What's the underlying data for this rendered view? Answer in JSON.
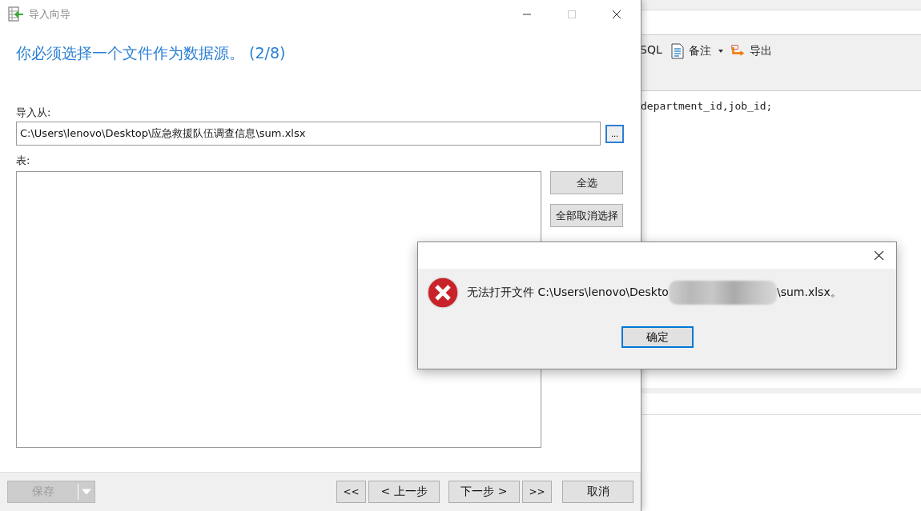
{
  "background_app": {
    "toolbar": [
      {
        "kind": "sql",
        "label": "SQL"
      },
      {
        "kind": "note",
        "label": "备注",
        "dropdown": true
      },
      {
        "kind": "export",
        "label": "导出"
      }
    ],
    "editor_line": "department_id,job_id;"
  },
  "wizard": {
    "title": "导入向导",
    "heading": "你必须选择一个文件作为数据源。 (2/8)",
    "source_label": "导入从:",
    "source_value": "C:\\Users\\lenovo\\Desktop\\应急救援队伍调查信息\\sum.xlsx",
    "browse_button": "...",
    "tables_label": "表:",
    "side_buttons": [
      "全选",
      "全部取消选择"
    ],
    "save_button": {
      "label": "保存",
      "disabled": true
    },
    "nav_buttons": [
      "<<",
      "< 上一步",
      "下一步 >",
      ">>",
      "取消"
    ]
  },
  "error_dialog": {
    "message_start": "无法打开文件 C:\\Users\\lenovo\\Deskto",
    "message_end": "\\sum.xlsx。",
    "ok_button": {
      "label": "确定",
      "focused": true
    }
  }
}
